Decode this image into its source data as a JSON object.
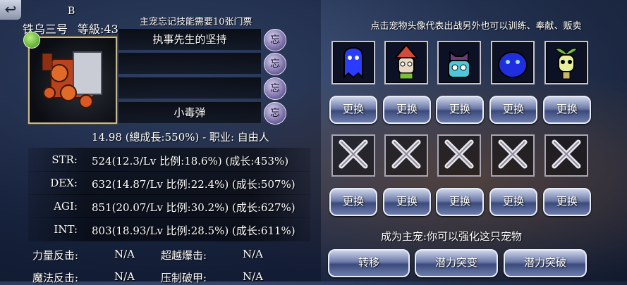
{
  "header": {
    "back_icon": "back-arrow-icon",
    "rank": "B",
    "name": "铁乌三号",
    "level": "等級:43",
    "skill_hint": "主宠忘记技能需要10张门票"
  },
  "skills": [
    {
      "name": "执事先生的坚持",
      "forget_label": "忘"
    },
    {
      "name": "",
      "forget_label": "忘"
    },
    {
      "name": "",
      "forget_label": "忘"
    },
    {
      "name": "小毒弹",
      "forget_label": "忘"
    }
  ],
  "growth": "14.98 (總成長:550%) - 职业: 自由人",
  "stats": [
    {
      "label": "STR:",
      "value": "524(12.3/Lv 比例:18.6%) (成长:453%)"
    },
    {
      "label": "DEX:",
      "value": "632(14.87/Lv 比例:22.4%) (成长:507%)"
    },
    {
      "label": "AGI:",
      "value": "851(20.07/Lv 比例:30.2%) (成长:627%)"
    },
    {
      "label": "INT:",
      "value": "803(18.93/Lv 比例:28.5%) (成长:611%)"
    }
  ],
  "extras": [
    {
      "label": "力量反击:",
      "value": "N/A",
      "label2": "超越爆击:",
      "value2": "N/A"
    },
    {
      "label": "魔法反击:",
      "value": "N/A",
      "label2": "压制破甲:",
      "value2": "N/A"
    }
  ],
  "right": {
    "hint": "点击宠物头像代表出战另外也可以训练、奉献、贩卖",
    "pets": [
      {
        "icon": "blue-ghost-pet-icon",
        "color": "#2a3cff"
      },
      {
        "icon": "witch-hat-pet-icon",
        "color": "#d24a3a"
      },
      {
        "icon": "cyan-beast-pet-icon",
        "color": "#4fc7d9"
      },
      {
        "icon": "blue-slime-pet-icon",
        "color": "#1f2fe0"
      },
      {
        "icon": "green-sprout-pet-icon",
        "color": "#e7ef9a"
      }
    ],
    "change_label": "更换",
    "empty_icon": "empty-slot-x-icon",
    "main_pet_hint": "成为主宠:你可以强化这只宠物",
    "actions": [
      "转移",
      "潜力突变",
      "潜力突破"
    ]
  }
}
